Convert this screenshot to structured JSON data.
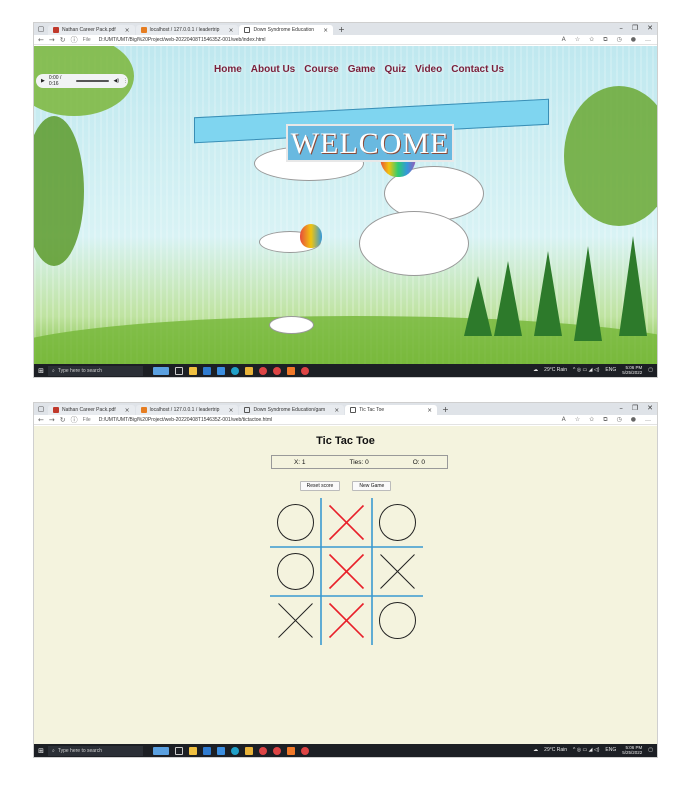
{
  "screens": [
    {
      "tabs": [
        {
          "label": "Nathan Career Pack.pdf",
          "color": "#c0392b"
        },
        {
          "label": "localhost / 127.0.0.1 / leadertrip",
          "color": "#e67e22"
        },
        {
          "label": "Down Syndrome Education",
          "color": "#555555"
        }
      ],
      "active_tab": 2,
      "url_scheme": "File",
      "url": "D:/UMT/UMT/Bigl%20Project/web-20220408T154635Z-001/web/index.html",
      "page": {
        "menu": [
          "Home",
          "About Us",
          "Course",
          "Game",
          "Quiz",
          "Video",
          "Contact Us"
        ],
        "audio_time": "0:00 / 0:16",
        "welcome": "WELCOME"
      }
    },
    {
      "tabs": [
        {
          "label": "Nathan Career Pack.pdf",
          "color": "#c0392b"
        },
        {
          "label": "localhost / 127.0.0.1 / leadertrip",
          "color": "#e67e22"
        },
        {
          "label": "Down Syndrome Education/gam",
          "color": "#555555"
        },
        {
          "label": "Tic Tac Toe",
          "color": "#555555"
        }
      ],
      "active_tab": 3,
      "url_scheme": "File",
      "url": "D:/UMT/UMT/Bigl%20Project/web-20220408T154635Z-001/web/tictactoe.html",
      "page": {
        "title": "Tic Tac Toe",
        "score_x": "X: 1",
        "score_ties": "Ties: 0",
        "score_o": "O: 0",
        "reset_label": "Reset score",
        "new_game_label": "New Game",
        "board": [
          "O",
          "X",
          "O",
          "O",
          "X",
          "X",
          "X",
          "X",
          "O"
        ],
        "board_red": [
          false,
          true,
          false,
          false,
          true,
          false,
          false,
          true,
          false
        ],
        "grid_color": "#3a9ad0",
        "red_color": "#e8202a"
      }
    }
  ],
  "taskbar": {
    "search_placeholder": "Type here to search",
    "weather": "29°C Rain",
    "lang": "ENG",
    "time": "5:06 PM",
    "date": "5/25/2022"
  }
}
